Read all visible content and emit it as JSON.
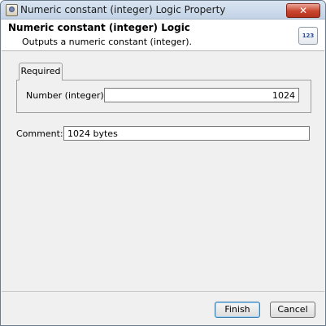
{
  "window": {
    "title": "Numeric constant (integer) Logic Property",
    "close_glyph": "✕"
  },
  "header": {
    "title": "Numeric constant (integer) Logic",
    "description": "Outputs a numeric constant (integer).",
    "icon_text": "123",
    "icon_name": "numeric-logic-icon"
  },
  "tabs": [
    {
      "label": "Required",
      "selected": true
    }
  ],
  "fields": {
    "number": {
      "label": "Number (integer):",
      "value": "1024"
    },
    "comment": {
      "label": "Comment:",
      "value": "1024 bytes"
    }
  },
  "buttons": {
    "finish": "Finish",
    "cancel": "Cancel"
  }
}
